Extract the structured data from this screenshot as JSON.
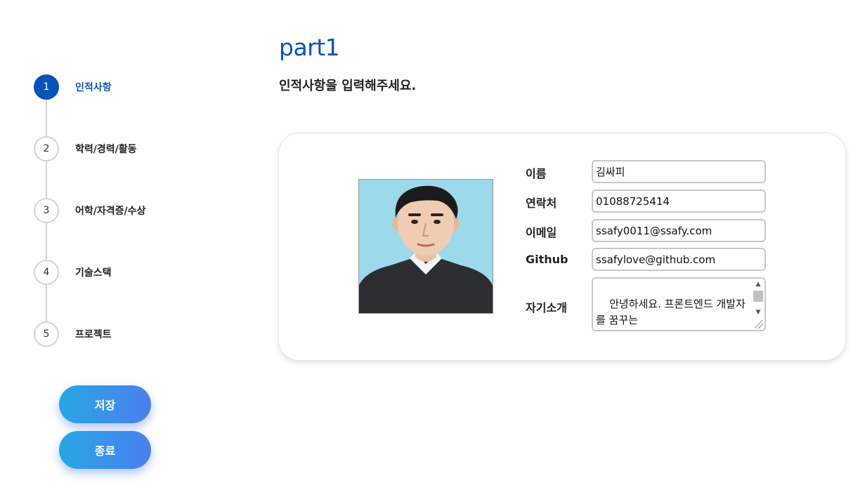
{
  "stepper": {
    "steps": [
      {
        "number": "1",
        "label": "인적사항",
        "active": true
      },
      {
        "number": "2",
        "label": "학력/경력/활동",
        "active": false
      },
      {
        "number": "3",
        "label": "어학/자격증/수상",
        "active": false
      },
      {
        "number": "4",
        "label": "기술스택",
        "active": false
      },
      {
        "number": "5",
        "label": "프로젝트",
        "active": false
      }
    ]
  },
  "actions": {
    "save_label": "저장",
    "exit_label": "종료"
  },
  "header": {
    "part_title": "part1",
    "subtitle": "인적사항을 입력해주세요."
  },
  "form": {
    "name": {
      "label": "이름",
      "value": "김싸피"
    },
    "phone": {
      "label": "연락처",
      "value": "01088725414"
    },
    "email": {
      "label": "이메일",
      "value": "ssafy0011@ssafy.com"
    },
    "github": {
      "label": "Github",
      "value": "ssafylove@github.com"
    },
    "intro": {
      "label": "자기소개",
      "value": "안녕하세요. 프론트엔드 개발자를 꿈꾸는 \n김싸피 지원자입니다."
    }
  },
  "colors": {
    "accent": "#0953b8",
    "button_gradient_start": "#27a7e4",
    "button_gradient_end": "#4a7fee",
    "photo_background": "#9cd9ea"
  }
}
